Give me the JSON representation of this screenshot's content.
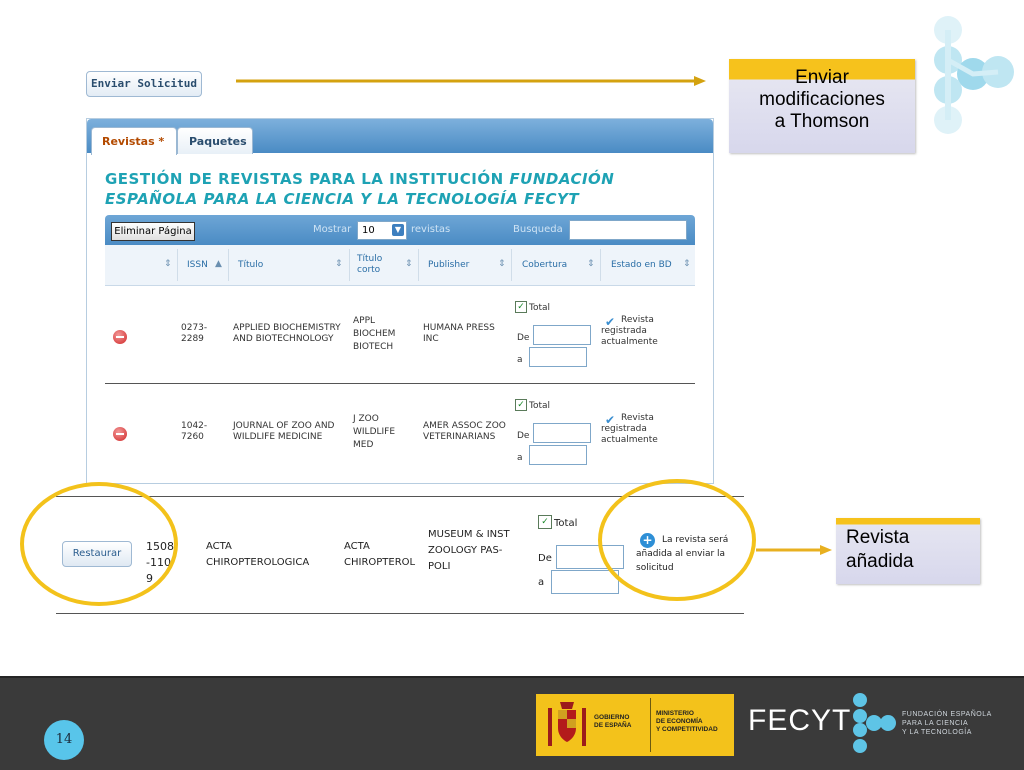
{
  "toolbar": {
    "send_request_label": "Enviar Solicitud"
  },
  "tabs": [
    {
      "label": "Revistas *"
    },
    {
      "label": "Paquetes"
    }
  ],
  "heading": {
    "line1_normal": "GESTIÓN DE REVISTAS PARA LA INSTITUCIÓN ",
    "line1_italic": "FUNDACIÓN",
    "line2_italic": "ESPAÑOLA PARA LA CIENCIA Y LA TECNOLOGÍA FECYT"
  },
  "grid_toolbar": {
    "delete_page_label": "Eliminar Página",
    "show_label": "Mostrar",
    "page_size": "10",
    "journals_label": "revistas",
    "search_label": "Busqueda",
    "search_value": ""
  },
  "columns": [
    "ISSN",
    "Título",
    "Título corto",
    "Publisher",
    "Cobertura",
    "Estado en BD"
  ],
  "rows": [
    {
      "issn": "0273-2289",
      "title": "APPLIED BIOCHEMISTRY AND BIOTECHNOLOGY",
      "short_title": "APPL BIOCHEM BIOTECH",
      "publisher": "HUMANA PRESS INC",
      "coverage_total": "Total",
      "from_label": "De",
      "to_label": "a",
      "status": "Revista registrada actualmente"
    },
    {
      "issn": "1042-7260",
      "title": "JOURNAL OF ZOO AND WILDLIFE MEDICINE",
      "short_title": "J ZOO WILDLIFE MED",
      "publisher": "AMER ASSOC ZOO VETERINARIANS",
      "coverage_total": "Total",
      "from_label": "De",
      "to_label": "a",
      "status": "Revista registrada actualmente"
    }
  ],
  "highlight_row": {
    "restore_label": "Restaurar",
    "issn": "1508-1109",
    "title": "ACTA CHIROPTEROLOGICA",
    "short_title": "ACTA CHIROPTEROL",
    "publisher": "MUSEUM & INST ZOOLOGY PAS-POLI",
    "coverage_total": "Total",
    "from_label": "De",
    "to_label": "a",
    "status": "La revista será añadida al enviar la solicitud"
  },
  "callouts": {
    "send_changes": [
      "Enviar",
      "modificaciones",
      "a Thomson"
    ],
    "added": [
      "Revista",
      "añadida"
    ]
  },
  "footer": {
    "slide_number": "14",
    "gov_spain": [
      "GOBIERNO",
      "DE ESPAÑA"
    ],
    "ministry": [
      "MINISTERIO",
      "DE ECONOMÍA",
      "Y COMPETITIVIDAD"
    ],
    "fecyt": "FECYT",
    "foundation": [
      "FUNDACIÓN ESPAÑOLA",
      "PARA LA CIENCIA",
      "Y LA TECNOLOGÍA"
    ]
  },
  "colors": {
    "accent_yellow": "#f6c21c",
    "heading_teal": "#1ea2b4",
    "footer_bg": "#3a3a3a",
    "logo_cyan": "#5ec4e6"
  }
}
